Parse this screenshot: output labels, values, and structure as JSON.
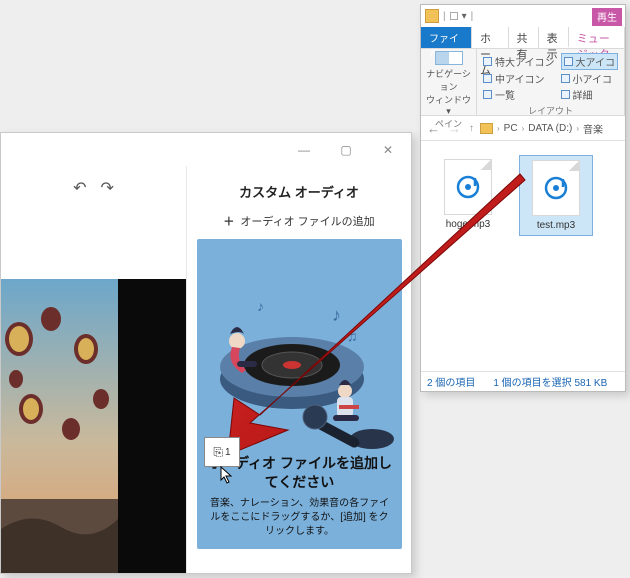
{
  "explorer": {
    "play_label": "再生",
    "tabs": {
      "file": "ファイル",
      "home": "ホーム",
      "share": "共有",
      "view": "表示",
      "music": "ミュージック"
    },
    "ribbon": {
      "nav_label": "ナビゲーション\nウィンドウ▾",
      "pane_group": "ペイン",
      "layout_group": "レイアウト",
      "opts": {
        "xl": "特大アイコン",
        "lg": "大アイコ",
        "md": "中アイコン",
        "sm": "小アイコ",
        "list": "一覧",
        "det": "詳細"
      }
    },
    "addr": {
      "pc": "PC",
      "drive": "DATA (D:)",
      "folder": "音楽"
    },
    "files": [
      {
        "name": "hoge.mp3",
        "selected": false
      },
      {
        "name": "test.mp3",
        "selected": true
      }
    ],
    "status": {
      "count": "2 個の項目",
      "sel": "1 個の項目を選択 581 KB"
    }
  },
  "editor": {
    "undo": "↶",
    "redo": "↷",
    "panel_title": "カスタム オーディオ",
    "add_label": "オーディオ ファイルの追加",
    "drop_head": "オーディオ ファイルを追加してください",
    "drop_desc": "音楽、ナレーション、効果音の各ファイルをここにドラッグするか、[追加] をクリックします。"
  },
  "drag": {
    "count": "1"
  }
}
